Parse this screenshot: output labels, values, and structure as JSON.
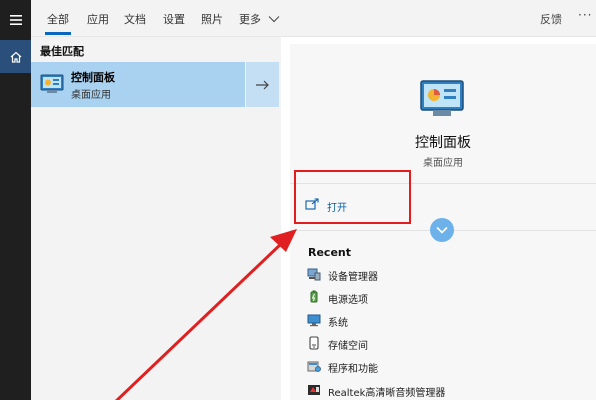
{
  "tabs": [
    {
      "label": "全部",
      "active": true
    },
    {
      "label": "应用"
    },
    {
      "label": "文档"
    },
    {
      "label": "设置"
    },
    {
      "label": "照片"
    },
    {
      "label": "更多"
    }
  ],
  "header": {
    "feedback_label": "反馈",
    "more_options": "···"
  },
  "left": {
    "section_title": "最佳匹配",
    "best_match": {
      "name": "控制面板",
      "subtitle": "桌面应用"
    }
  },
  "right": {
    "app_name": "控制面板",
    "app_type": "桌面应用",
    "open_label": "打开",
    "recent_title": "Recent",
    "recent_items": [
      {
        "label": "设备管理器",
        "icon": "device-manager-icon"
      },
      {
        "label": "电源选项",
        "icon": "power-options-icon"
      },
      {
        "label": "系统",
        "icon": "system-icon"
      },
      {
        "label": "存储空间",
        "icon": "storage-icon"
      },
      {
        "label": "程序和功能",
        "icon": "programs-features-icon"
      },
      {
        "label": "Realtek高清晰音频管理器",
        "icon": "realtek-audio-icon"
      }
    ]
  },
  "colors": {
    "accent": "#0a67c0",
    "selection": "#a9d1f0",
    "annotation_red": "#e21d1d",
    "sidebar_bg": "#1f1f1f"
  }
}
